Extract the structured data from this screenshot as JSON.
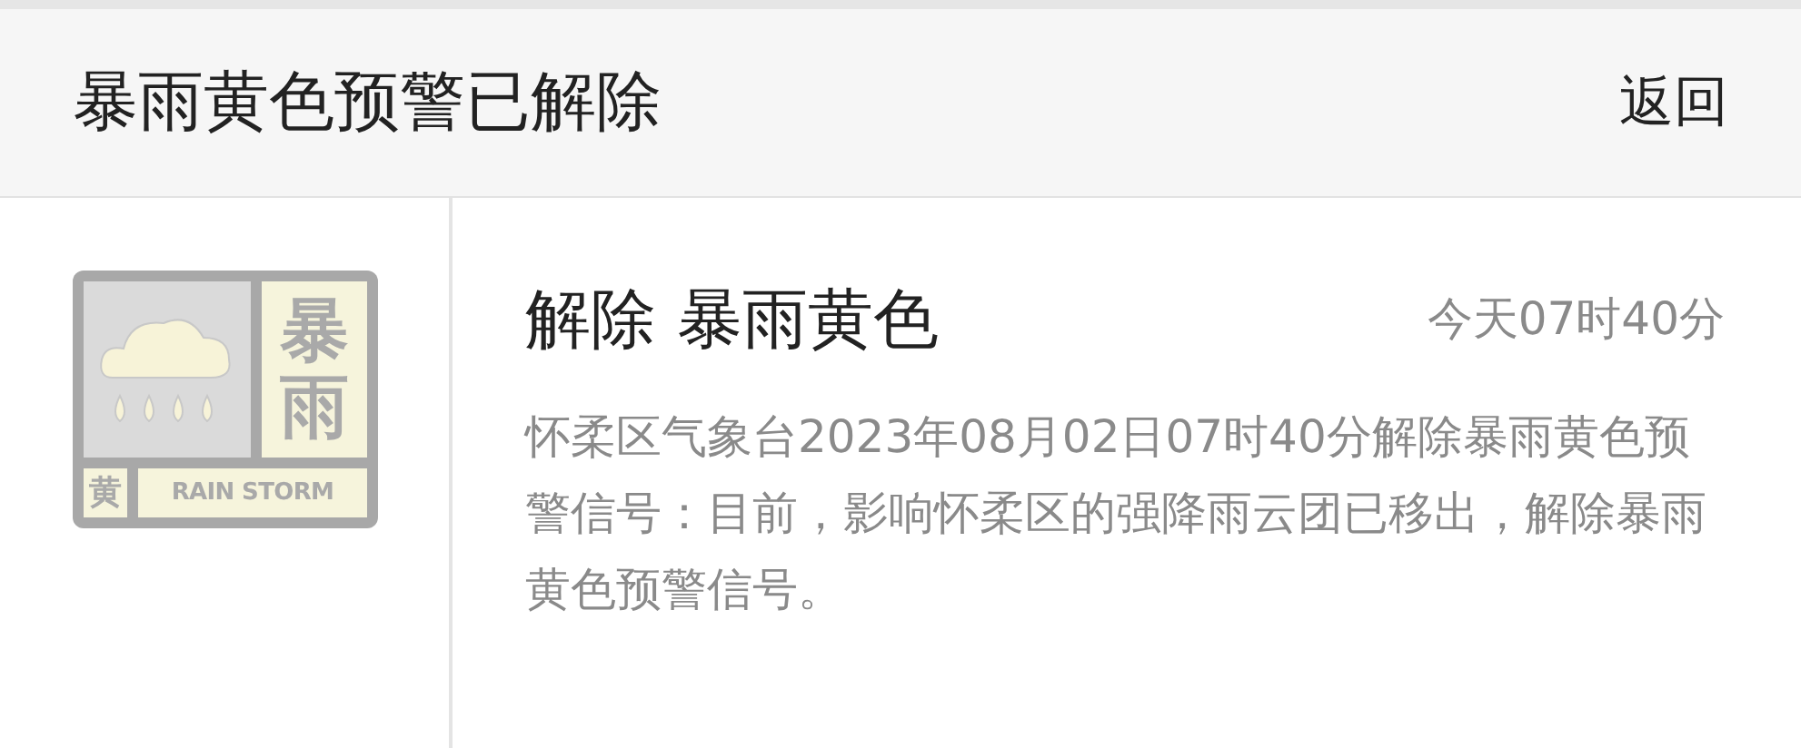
{
  "header": {
    "title": "暴雨黄色预警已解除",
    "back": "返回"
  },
  "alert": {
    "badge": {
      "vertical_text": "暴雨",
      "color_text": "黄",
      "english_text": "RAIN STORM"
    },
    "title": "解除 暴雨黄色",
    "time": "今天07时40分",
    "description": "怀柔区气象台2023年08月02日07时40分解除暴雨黄色预警信号：目前，影响怀柔区的强降雨云团已移出，解除暴雨黄色预警信号。"
  }
}
